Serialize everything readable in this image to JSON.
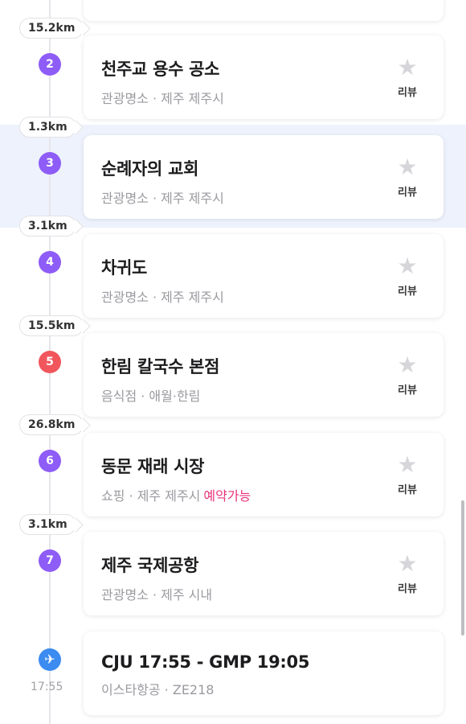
{
  "review_label": "리뷰",
  "distances": [
    "15.2km",
    "1.3km",
    "3.1km",
    "15.5km",
    "26.8km",
    "3.1km"
  ],
  "stops": [
    {
      "num": "2",
      "title": "천주교 용수 공소",
      "sub": "관광명소 · 제주 제주시",
      "tag": "",
      "color": "purple"
    },
    {
      "num": "3",
      "title": "순례자의 교회",
      "sub": "관광명소 · 제주 제주시",
      "tag": "",
      "color": "purple"
    },
    {
      "num": "4",
      "title": "차귀도",
      "sub": "관광명소 · 제주 제주시",
      "tag": "",
      "color": "purple"
    },
    {
      "num": "5",
      "title": "한림 칼국수 본점",
      "sub": "음식점 · 애월·한림",
      "tag": "",
      "color": "red"
    },
    {
      "num": "6",
      "title": "동문 재래 시장",
      "sub": "쇼핑 · 제주 제주시",
      "tag": "예약가능",
      "color": "purple"
    },
    {
      "num": "7",
      "title": "제주 국제공항",
      "sub": "관광명소 · 제주 시내",
      "tag": "",
      "color": "purple"
    }
  ],
  "flight": {
    "route": "CJU 17:55 - GMP 19:05",
    "info": "이스타항공 · ZE218",
    "time": "17:55",
    "icon": "airplane-icon"
  },
  "colors": {
    "purple": "#8e5cf6",
    "red": "#f0565c",
    "tag": "#e8337a",
    "plane": "#3b8bf0",
    "highlight": "#eef2fc"
  }
}
